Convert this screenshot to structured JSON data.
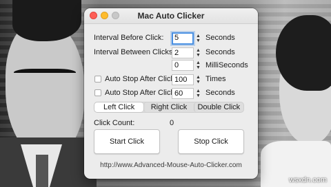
{
  "window": {
    "title": "Mac Auto Clicker"
  },
  "interval_before": {
    "label": "Interval Before Click:",
    "value": "5",
    "unit": "Seconds"
  },
  "interval_between": {
    "label": "Interval Between Clicks:",
    "seconds_value": "2",
    "seconds_unit": "Seconds",
    "ms_value": "0",
    "ms_unit": "MilliSeconds"
  },
  "auto_stop_clicks": {
    "label": "Auto Stop After Click",
    "value": "100",
    "unit": "Times",
    "checked": false
  },
  "auto_stop_seconds": {
    "label": "Auto Stop After Click",
    "value": "60",
    "unit": "Seconds",
    "checked": false
  },
  "click_type": {
    "options": [
      "Left Click",
      "Right Click",
      "Double Click"
    ],
    "selected": "Left Click"
  },
  "click_count": {
    "label": "Click Count:",
    "value": "0"
  },
  "buttons": {
    "start": "Start  Click",
    "stop": "Stop  Click"
  },
  "footer": {
    "url": "http://www.Advanced-Mouse-Auto-Clicker.com"
  },
  "watermark": "wsxdn.com",
  "colors": {
    "focus_ring": "#4a90e2",
    "close": "#fe5f57",
    "minimize": "#febc2e"
  }
}
